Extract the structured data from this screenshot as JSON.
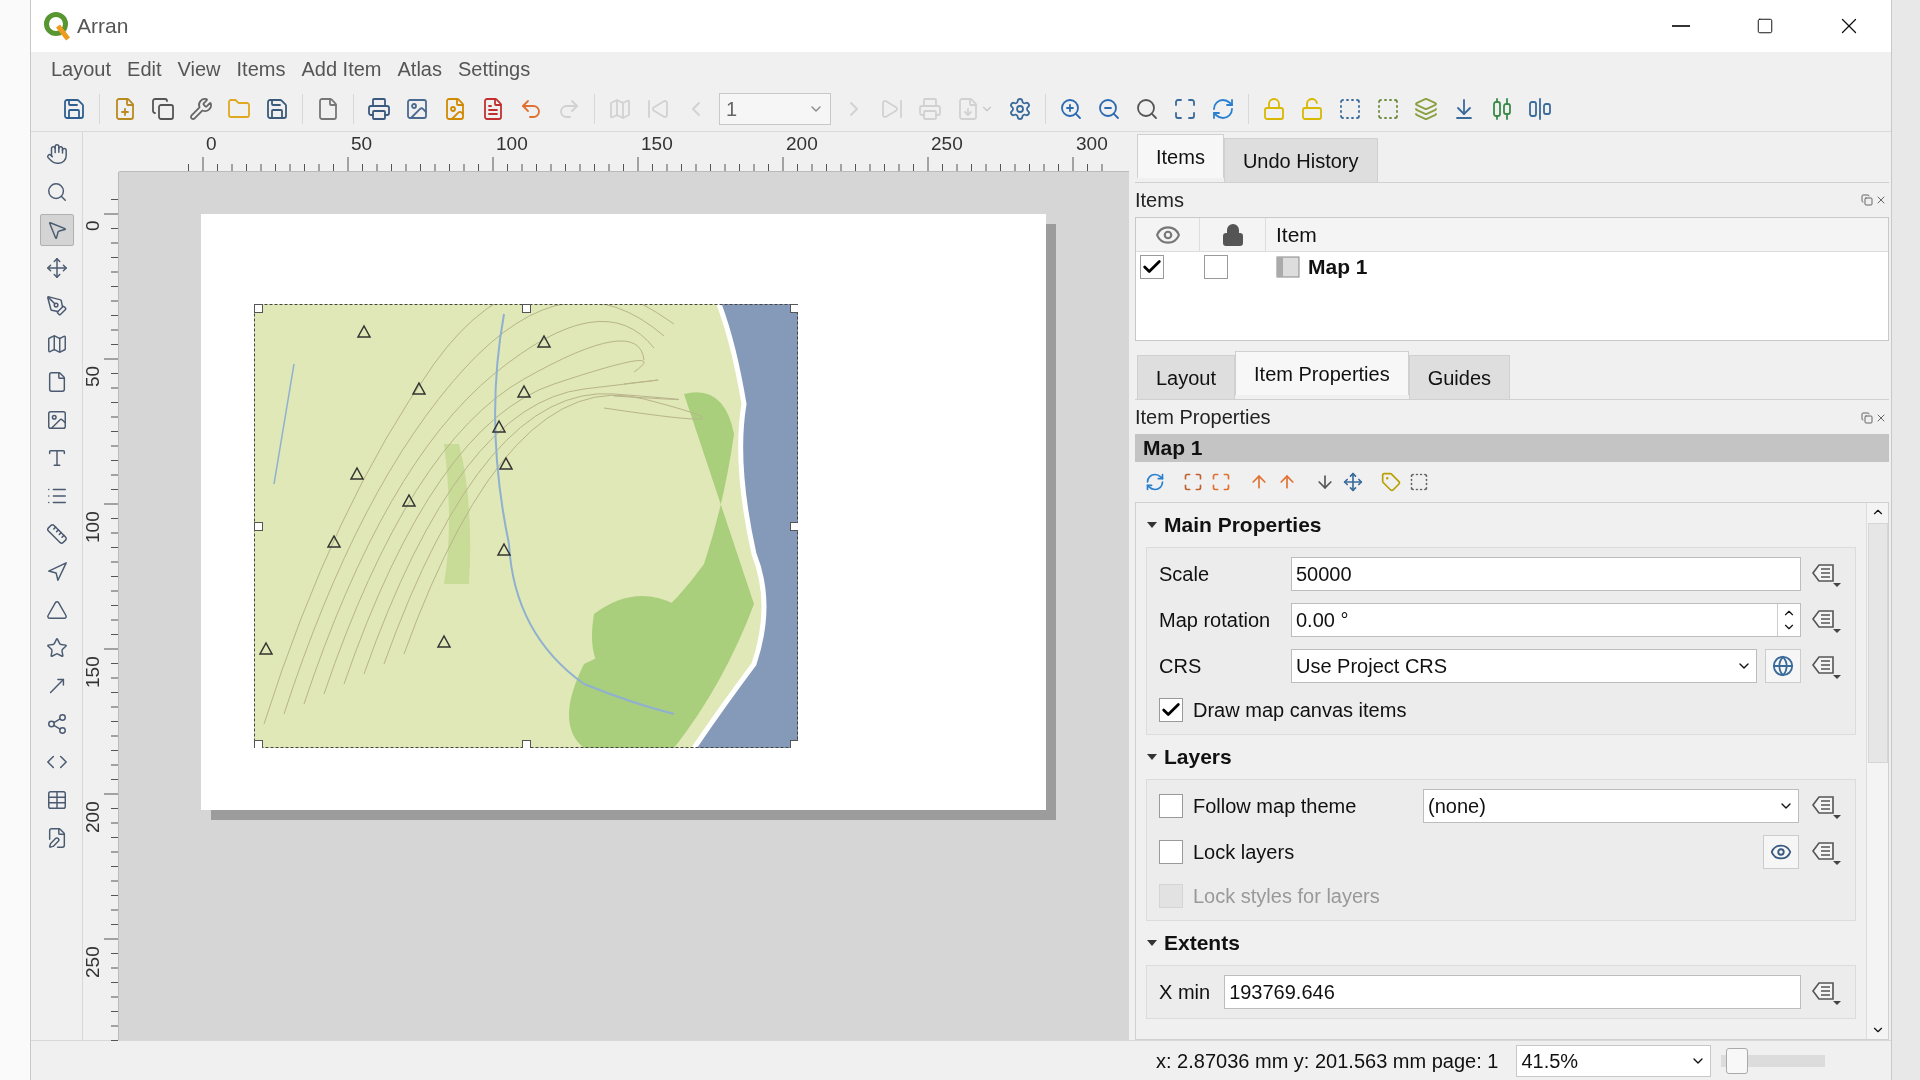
{
  "window": {
    "title": "Arran"
  },
  "menu": [
    "Layout",
    "Edit",
    "View",
    "Items",
    "Add Item",
    "Atlas",
    "Settings"
  ],
  "toolbar": {
    "page_field": "1",
    "buttons": [
      {
        "disabled": false
      },
      {
        "disabled": false
      },
      {
        "disabled": false
      },
      {
        "disabled": false
      },
      {
        "disabled": false
      },
      {
        "disabled": false
      },
      {
        "disabled": false
      },
      {
        "disabled": false
      },
      {
        "disabled": false
      },
      {
        "disabled": false
      },
      {
        "disabled": false
      },
      {
        "disabled": false
      },
      {
        "disabled": true
      },
      {
        "disabled": true
      },
      {
        "disabled": true
      },
      {
        "disabled": true
      },
      {
        "disabled": true
      },
      {
        "disabled": true
      },
      {
        "disabled": true
      },
      {
        "disabled": true
      },
      {
        "disabled": false
      },
      {
        "disabled": false
      },
      {
        "disabled": false
      },
      {
        "disabled": false
      },
      {
        "disabled": false
      },
      {
        "disabled": false
      },
      {
        "disabled": false
      },
      {
        "disabled": false
      },
      {
        "disabled": false
      },
      {
        "disabled": false
      },
      {
        "disabled": false
      },
      {
        "disabled": false
      },
      {
        "disabled": false
      },
      {
        "disabled": false
      }
    ]
  },
  "tools": [
    {
      "selected": false
    },
    {
      "selected": false
    },
    {
      "selected": true
    },
    {
      "selected": false
    },
    {
      "selected": false
    },
    {
      "selected": false
    },
    {
      "selected": false
    },
    {
      "selected": false
    },
    {
      "selected": false
    },
    {
      "selected": false
    },
    {
      "selected": false
    },
    {
      "selected": false
    },
    {
      "selected": false
    },
    {
      "selected": false
    },
    {
      "selected": false
    },
    {
      "selected": false
    },
    {
      "selected": false
    },
    {
      "selected": false
    },
    {
      "selected": false
    }
  ],
  "rulers": {
    "horizontal": [
      "0",
      "50",
      "100",
      "150",
      "200",
      "250",
      "300"
    ],
    "vertical": [
      "0",
      "50",
      "100",
      "150",
      "200",
      "250"
    ]
  },
  "items_dock": {
    "tabs": [
      {
        "label": "Items",
        "selected": true
      },
      {
        "label": "Undo History",
        "selected": false
      }
    ],
    "title": "Items",
    "column": "Item",
    "rows": [
      {
        "visible": true,
        "locked": false,
        "name": "Map 1"
      }
    ]
  },
  "properties_dock": {
    "tabs": [
      {
        "label": "Layout",
        "selected": false
      },
      {
        "label": "Item Properties",
        "selected": true
      },
      {
        "label": "Guides",
        "selected": false
      }
    ],
    "title": "Item Properties",
    "item_name": "Map 1",
    "sections": [
      {
        "title": "Main Properties",
        "expanded": true,
        "rows": [
          {
            "kind": "field",
            "label": "Scale",
            "value": "50000"
          },
          {
            "kind": "spin",
            "label": "Map rotation",
            "value": "0.00 °"
          },
          {
            "kind": "crs",
            "label": "CRS",
            "value": "Use Project CRS"
          },
          {
            "kind": "check",
            "label": "Draw map canvas items",
            "checked": true,
            "disabled": false
          }
        ]
      },
      {
        "title": "Layers",
        "expanded": true,
        "rows": [
          {
            "kind": "theme",
            "label": "Follow map theme",
            "checked": false,
            "disabled": false,
            "value": "(none)"
          },
          {
            "kind": "lock",
            "label": "Lock layers",
            "checked": false,
            "disabled": false
          },
          {
            "kind": "check",
            "label": "Lock styles for layers",
            "checked": false,
            "disabled": true
          }
        ]
      },
      {
        "title": "Extents",
        "expanded": true,
        "rows": [
          {
            "kind": "field",
            "label": "X min",
            "value": "193769.646"
          }
        ]
      }
    ]
  },
  "status_bar": {
    "coordinates": "x: 2.87036 mm y: 201.563 mm page: 1",
    "zoom": "41.5%",
    "zoom_slider": {
      "level": 0.05
    }
  }
}
